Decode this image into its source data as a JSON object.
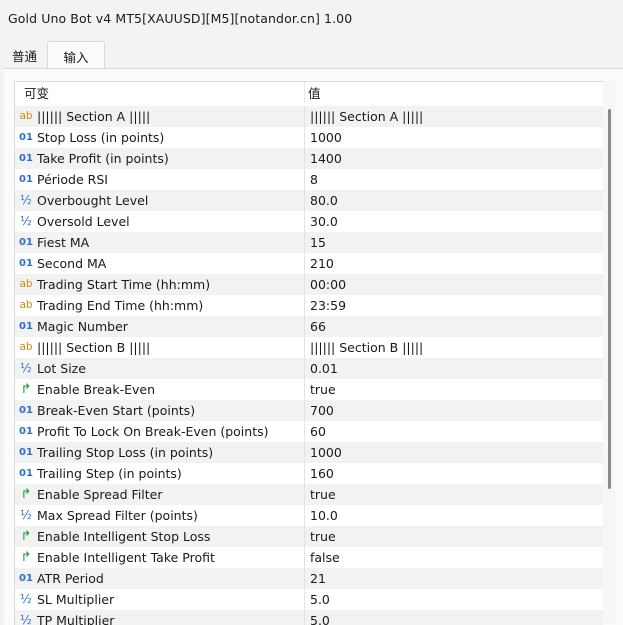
{
  "window": {
    "title": "Gold Uno Bot v4 MT5[XAUUSD][M5][notandor.cn] 1.00"
  },
  "tabs": [
    "普通",
    "输入"
  ],
  "table": {
    "headers": {
      "variable": "可变",
      "value": "值"
    },
    "rows": [
      {
        "type": "str",
        "icon": "string-type-icon",
        "icon_text": "ab",
        "name": "|||||| Section A |||||",
        "value": "|||||| Section A |||||"
      },
      {
        "type": "int",
        "icon": "integer-type-icon",
        "icon_text": "01",
        "name": "Stop Loss (in points)",
        "value": "1000"
      },
      {
        "type": "int",
        "icon": "integer-type-icon",
        "icon_text": "01",
        "name": "Take Profit (in points)",
        "value": "1400"
      },
      {
        "type": "int",
        "icon": "integer-type-icon",
        "icon_text": "01",
        "name": "Période RSI",
        "value": "8"
      },
      {
        "type": "dbl",
        "icon": "double-type-icon",
        "icon_text": "½",
        "name": "Overbought Level",
        "value": "80.0"
      },
      {
        "type": "dbl",
        "icon": "double-type-icon",
        "icon_text": "½",
        "name": "Oversold Level",
        "value": "30.0"
      },
      {
        "type": "int",
        "icon": "integer-type-icon",
        "icon_text": "01",
        "name": "Fiest MA",
        "value": "15"
      },
      {
        "type": "int",
        "icon": "integer-type-icon",
        "icon_text": "01",
        "name": "Second MA",
        "value": "210"
      },
      {
        "type": "str",
        "icon": "string-type-icon",
        "icon_text": "ab",
        "name": "Trading Start Time (hh:mm)",
        "value": "00:00"
      },
      {
        "type": "str",
        "icon": "string-type-icon",
        "icon_text": "ab",
        "name": "Trading End Time (hh:mm)",
        "value": "23:59"
      },
      {
        "type": "int",
        "icon": "integer-type-icon",
        "icon_text": "01",
        "name": "Magic Number",
        "value": "66"
      },
      {
        "type": "str",
        "icon": "string-type-icon",
        "icon_text": "ab",
        "name": "|||||| Section B |||||",
        "value": "|||||| Section B |||||"
      },
      {
        "type": "dbl",
        "icon": "double-type-icon",
        "icon_text": "½",
        "name": "Lot Size",
        "value": "0.01"
      },
      {
        "type": "bool",
        "icon": "boolean-type-icon",
        "icon_text": "↱",
        "name": "Enable Break-Even",
        "value": "true"
      },
      {
        "type": "int",
        "icon": "integer-type-icon",
        "icon_text": "01",
        "name": "Break-Even Start (points)",
        "value": "700"
      },
      {
        "type": "int",
        "icon": "integer-type-icon",
        "icon_text": "01",
        "name": "Profit To Lock On Break-Even (points)",
        "value": "60"
      },
      {
        "type": "int",
        "icon": "integer-type-icon",
        "icon_text": "01",
        "name": "Trailing Stop Loss (in points)",
        "value": "1000"
      },
      {
        "type": "int",
        "icon": "integer-type-icon",
        "icon_text": "01",
        "name": "Trailing Step (in points)",
        "value": "160"
      },
      {
        "type": "bool",
        "icon": "boolean-type-icon",
        "icon_text": "↱",
        "name": "Enable Spread Filter",
        "value": "true"
      },
      {
        "type": "dbl",
        "icon": "double-type-icon",
        "icon_text": "½",
        "name": "Max Spread Filter (points)",
        "value": "10.0"
      },
      {
        "type": "bool",
        "icon": "boolean-type-icon",
        "icon_text": "↱",
        "name": "Enable Intelligent Stop Loss",
        "value": "true"
      },
      {
        "type": "bool",
        "icon": "boolean-type-icon",
        "icon_text": "↱",
        "name": "Enable Intelligent Take Profit",
        "value": "false"
      },
      {
        "type": "int",
        "icon": "integer-type-icon",
        "icon_text": "01",
        "name": "ATR Period",
        "value": "21"
      },
      {
        "type": "dbl",
        "icon": "double-type-icon",
        "icon_text": "½",
        "name": "SL Multiplier",
        "value": "5.0"
      },
      {
        "type": "dbl",
        "icon": "double-type-icon",
        "icon_text": "½",
        "name": "TP Multiplier",
        "value": "5.0"
      }
    ]
  },
  "colors": {
    "integer_icon": "#2a6fc9",
    "string_icon": "#c98b14",
    "boolean_icon": "#1f9a3c",
    "row_alt": "#f2f2f2"
  }
}
